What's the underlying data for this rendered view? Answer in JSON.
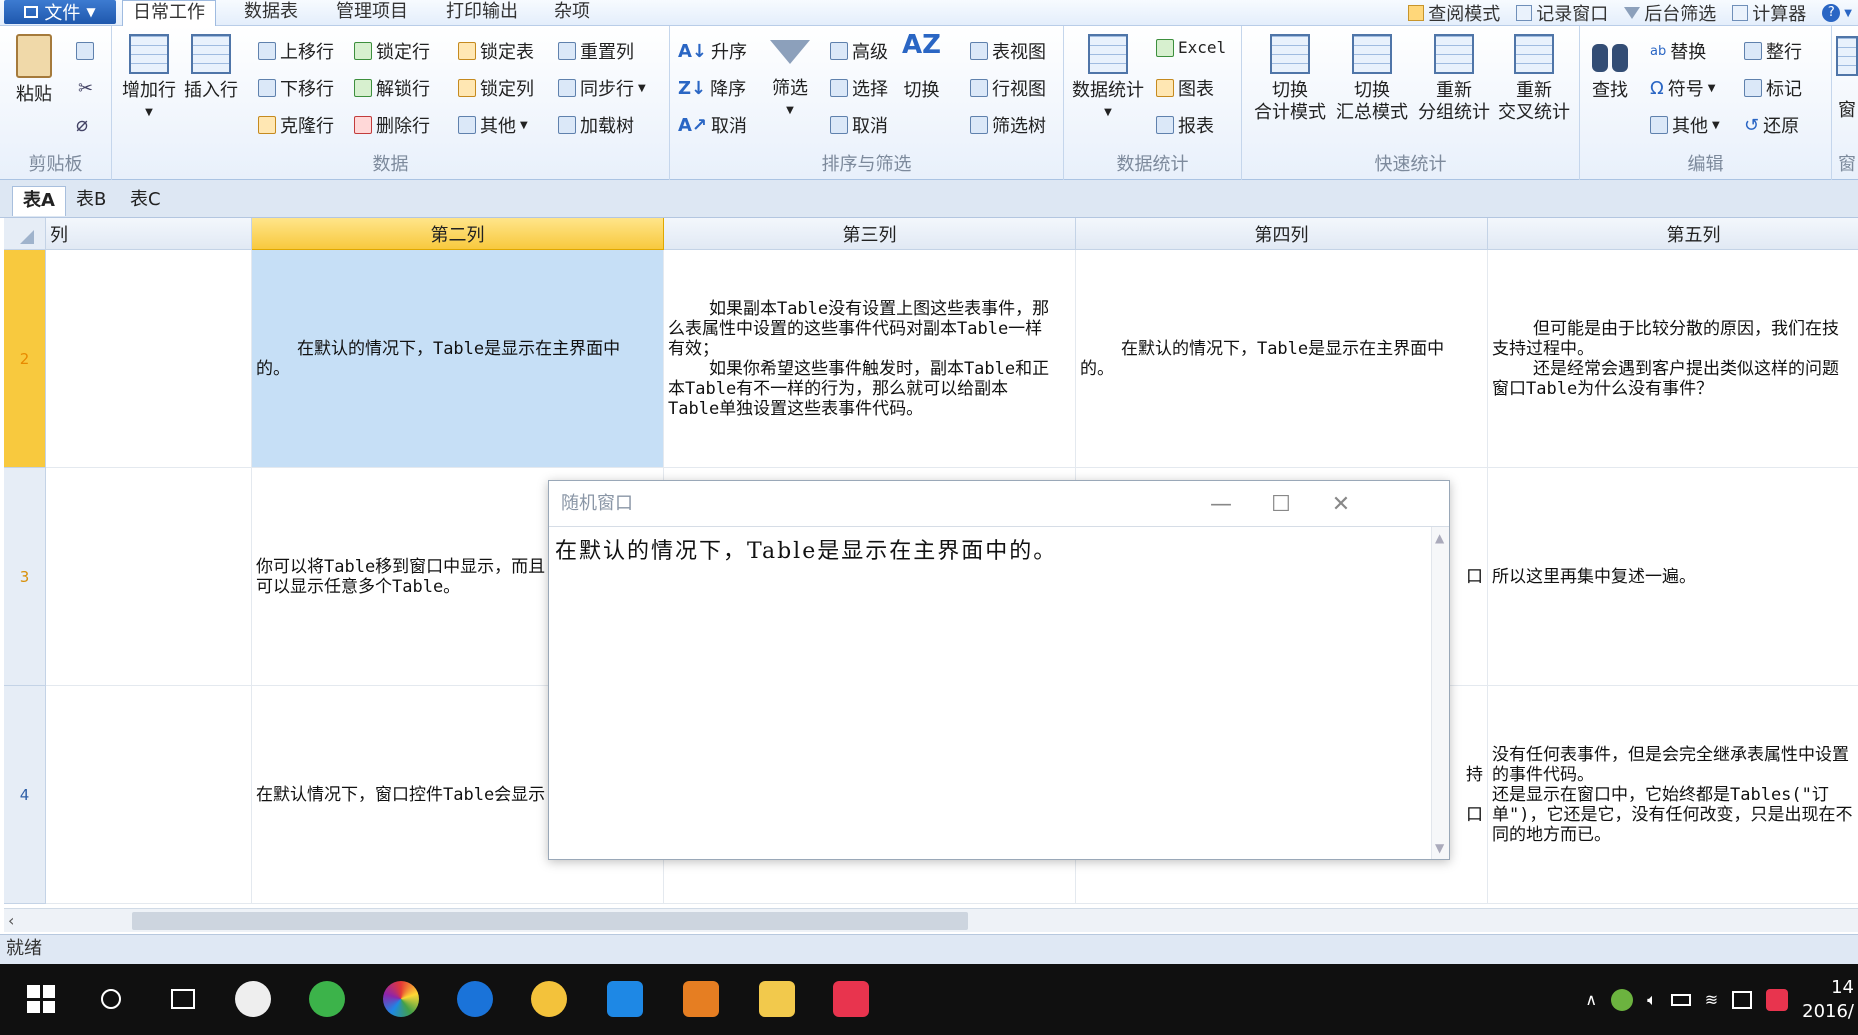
{
  "menubar": {
    "file_label": "文件",
    "tabs": [
      "日常工作",
      "数据表",
      "管理项目",
      "打印输出",
      "杂项"
    ],
    "right_items": [
      "查阅模式",
      "记录窗口",
      "后台筛选",
      "计算器"
    ]
  },
  "ribbon": {
    "clipboard": {
      "paste": "粘贴",
      "group": "剪贴板"
    },
    "data": {
      "add_row": "增加行",
      "insert_row": "插入行",
      "move_up": "上移行",
      "move_down": "下移行",
      "clone_row": "克隆行",
      "lock_row": "锁定行",
      "unlock_row": "解锁行",
      "delete_row": "删除行",
      "lock_table": "锁定表",
      "lock_col": "锁定列",
      "other": "其他",
      "reset_col": "重置列",
      "sync_row": "同步行",
      "load_tree": "加载树",
      "group": "数据"
    },
    "sort": {
      "asc": "升序",
      "desc": "降序",
      "cancel": "取消",
      "filter": "筛选",
      "advanced": "高级",
      "select": "选择",
      "cancel2": "取消",
      "switch": "切换",
      "group": "排序与筛选"
    },
    "views": {
      "table_view": "表视图",
      "row_view": "行视图",
      "filter_tree": "筛选树"
    },
    "stats": {
      "data_stats": "数据统计",
      "excel": "Excel",
      "chart": "图表",
      "report": "报表",
      "group": "数据统计"
    },
    "quick": {
      "b1_top": "切换",
      "b1_bot": "合计模式",
      "b2_top": "切换",
      "b2_bot": "汇总模式",
      "b3_top": "重新",
      "b3_bot": "分组统计",
      "b4_top": "重新",
      "b4_bot": "交叉统计",
      "group": "快速统计"
    },
    "edit": {
      "find": "查找",
      "replace": "替换",
      "symbol": "符号",
      "other": "其他",
      "whole_row": "整行",
      "mark": "标记",
      "restore": "还原",
      "group": "编辑"
    },
    "extra": {
      "top": "窗",
      "bottom": "窗"
    }
  },
  "sheets": [
    "表A",
    "表B",
    "表C"
  ],
  "grid": {
    "first_col_fragment": "列",
    "columns": [
      "第二列",
      "第三列",
      "第四列",
      "第五列"
    ],
    "rows": [
      {
        "num": "2",
        "cells": [
          "    在默认的情况下，Table是显示在主界面中\n的。",
          "    如果副本Table没有设置上图这些表事件，那\n么表属性中设置的这些事件代码对副本Table一样\n有效；\n    如果你希望这些事件触发时，副本Table和正\n本Table有不一样的行为，那么就可以给副本\nTable单独设置这些表事件代码。",
          "    在默认的情况下，Table是显示在主界面中\n的。",
          "    但可能是由于比较分散的原因，我们在技\n支持过程中。\n    还是经常会遇到客户提出类似这样的问题\n窗口Table为什么没有事件？"
        ]
      },
      {
        "num": "3",
        "cells": [
          "你可以将Table移到窗口中显示，而且\n可以显示任意多个Table。",
          "",
          "口",
          "所以这里再集中复述一遍。"
        ]
      },
      {
        "num": "4",
        "cells": [
          "在默认情况下，窗口控件Table会显示",
          "",
          "持\n\n口",
          "没有任何表事件，但是会完全继承表属性中设置\n的事件代码。\n还是显示在窗口中，它始终都是Tables(\"订\n单\")，它还是它，没有任何改变，只是出现在不\n同的地方而已。"
        ]
      }
    ]
  },
  "status": {
    "text": "就绪"
  },
  "popup": {
    "title": "随机窗口",
    "content": "在默认的情况下，Table是显示在主界面中的。",
    "minimize": "—",
    "maximize": "☐",
    "close": "✕"
  },
  "taskbar": {
    "clock_time": "14",
    "clock_date": "2016/"
  },
  "colors": {
    "ribbon_bg": "#e8f0fb",
    "selected_header": "#f8c93e",
    "selected_cell": "#c6dff6",
    "taskbar": "#101010"
  }
}
